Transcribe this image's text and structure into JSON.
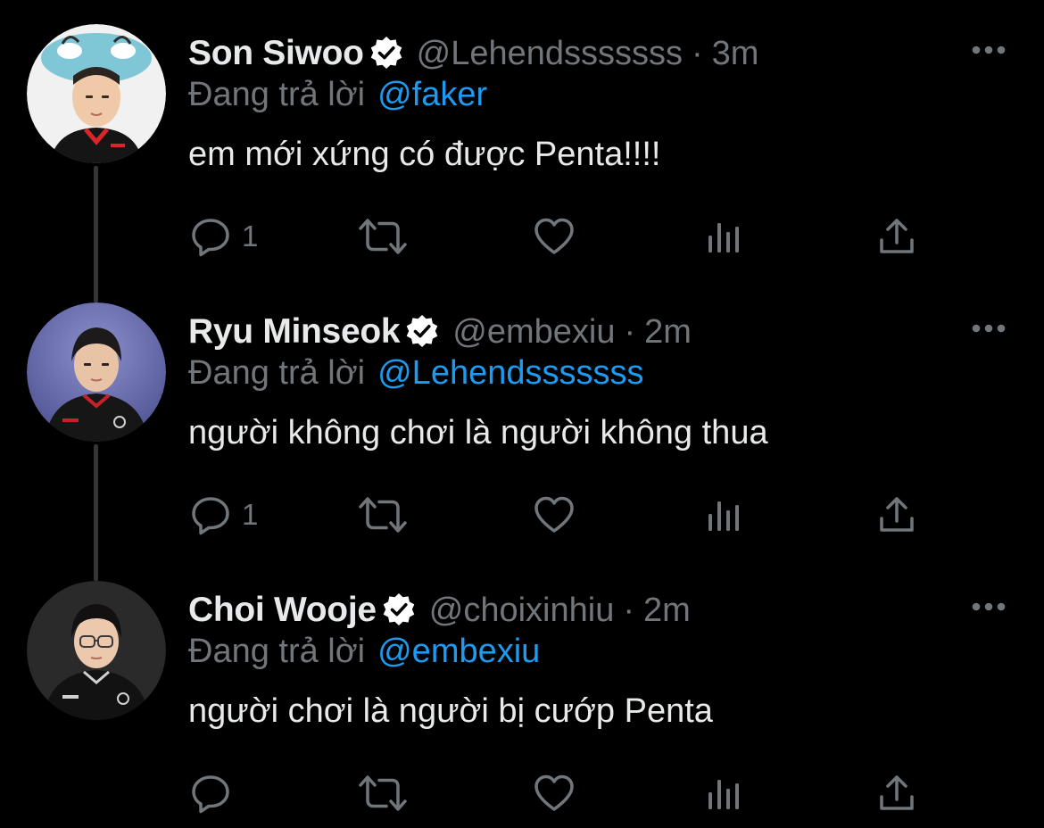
{
  "colors": {
    "background": "#000000",
    "text_primary": "#e7e9ea",
    "text_secondary": "#71767b",
    "accent": "#1d9bf0",
    "thread_line": "#333639",
    "verified_badge": "#ffffff"
  },
  "reply_prefix": "Đang trả lời",
  "tweets": [
    {
      "display_name": "Son Siwoo",
      "handle": "@Lehendsssssss",
      "separator": "·",
      "time": "3m",
      "reply_to": "@faker",
      "text": "em mới xứng có được Penta!!!!",
      "reply_count": "1",
      "verified_icon": "verified-badge-icon",
      "more_icon": "more-dots-icon"
    },
    {
      "display_name": "Ryu Minseok",
      "handle": "@embexiu",
      "separator": "·",
      "time": "2m",
      "reply_to": "@Lehendsssssss",
      "text": "người không chơi là người không thua",
      "reply_count": "1",
      "verified_icon": "verified-badge-icon",
      "more_icon": "more-dots-icon"
    },
    {
      "display_name": "Choi Wooje",
      "handle": "@choixinhiu",
      "separator": "·",
      "time": "2m",
      "reply_to": "@embexiu",
      "text": "người chơi là người bị cướp Penta",
      "reply_count": "",
      "verified_icon": "verified-badge-icon",
      "more_icon": "more-dots-icon"
    }
  ],
  "action_icons": [
    "reply-icon",
    "retweet-icon",
    "like-icon",
    "views-icon",
    "share-icon"
  ]
}
